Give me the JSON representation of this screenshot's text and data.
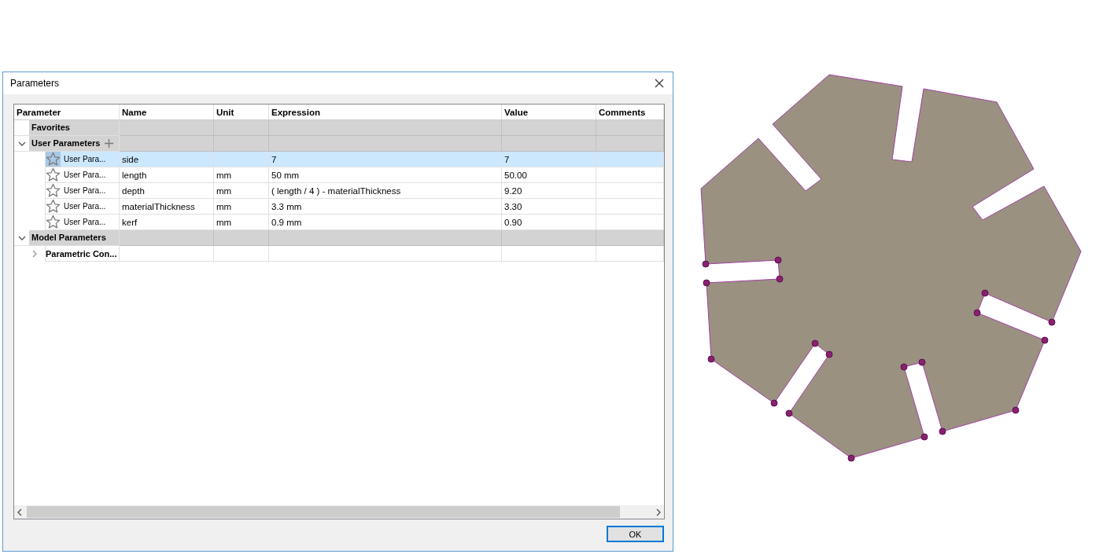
{
  "window": {
    "title": "Parameters"
  },
  "columns": [
    "Parameter",
    "Name",
    "Unit",
    "Expression",
    "Value",
    "Comments"
  ],
  "groups": [
    {
      "label": "Favorites",
      "add_icon": false
    },
    {
      "label": "User Parameters",
      "expanded": true,
      "add_icon": true,
      "parameters": [
        {
          "type_label": "User Para...",
          "favorite": false,
          "selected": true,
          "name": "side",
          "expression": "7",
          "value": "7"
        },
        {
          "type_label": "User Para...",
          "favorite": false,
          "selected": false,
          "name": "length",
          "unit": "mm",
          "expression": "50 mm",
          "value": "50.00"
        },
        {
          "type_label": "User Para...",
          "favorite": false,
          "selected": false,
          "name": "depth",
          "unit": "mm",
          "expression": "( length / 4 ) - materialThickness",
          "value": "9.20"
        },
        {
          "type_label": "User Para...",
          "favorite": false,
          "selected": false,
          "name": "materialThickness",
          "unit": "mm",
          "expression": "3.3 mm",
          "value": "3.30"
        },
        {
          "type_label": "User Para...",
          "favorite": false,
          "selected": false,
          "name": "kerf",
          "unit": "mm",
          "expression": "0.9 mm",
          "value": "0.90"
        }
      ]
    },
    {
      "label": "Model Parameters",
      "expanded": true,
      "add_icon": false,
      "children": [
        {
          "label": "Parametric Con...",
          "expanded": false
        }
      ]
    }
  ],
  "buttons": [
    {
      "label": "OK",
      "default": true
    }
  ]
}
